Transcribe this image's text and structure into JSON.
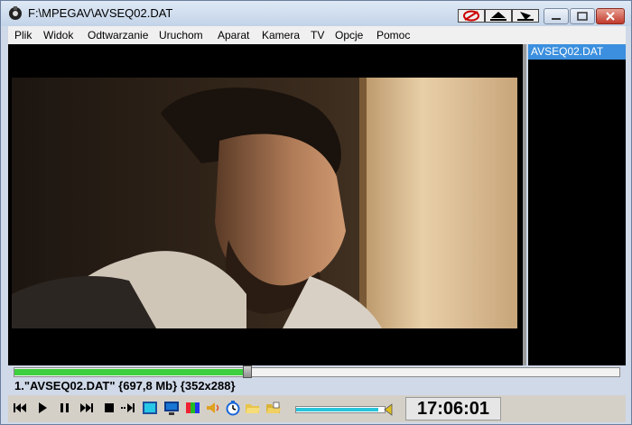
{
  "window": {
    "title": "F:\\MPEGAV\\AVSEQ02.DAT"
  },
  "menu": [
    "Plik",
    "Widok",
    "Odtwarzanie",
    "Uruchom",
    "Aparat",
    "Kamera",
    "TV",
    "Opcje",
    "Pomoc"
  ],
  "playlist": {
    "items": [
      "AVSEQ02.DAT"
    ]
  },
  "status": {
    "file_info": "1.\"AVSEQ02.DAT\" {697,8 Mb} {352x288}"
  },
  "playback": {
    "progress_fraction": 0.385,
    "volume_fraction": 0.93
  },
  "clock": "17:06:01",
  "colors": {
    "seek_fill": "#3ecf3e",
    "volume_fill": "#28c5d9",
    "playlist_selected": "#3b8fde"
  }
}
